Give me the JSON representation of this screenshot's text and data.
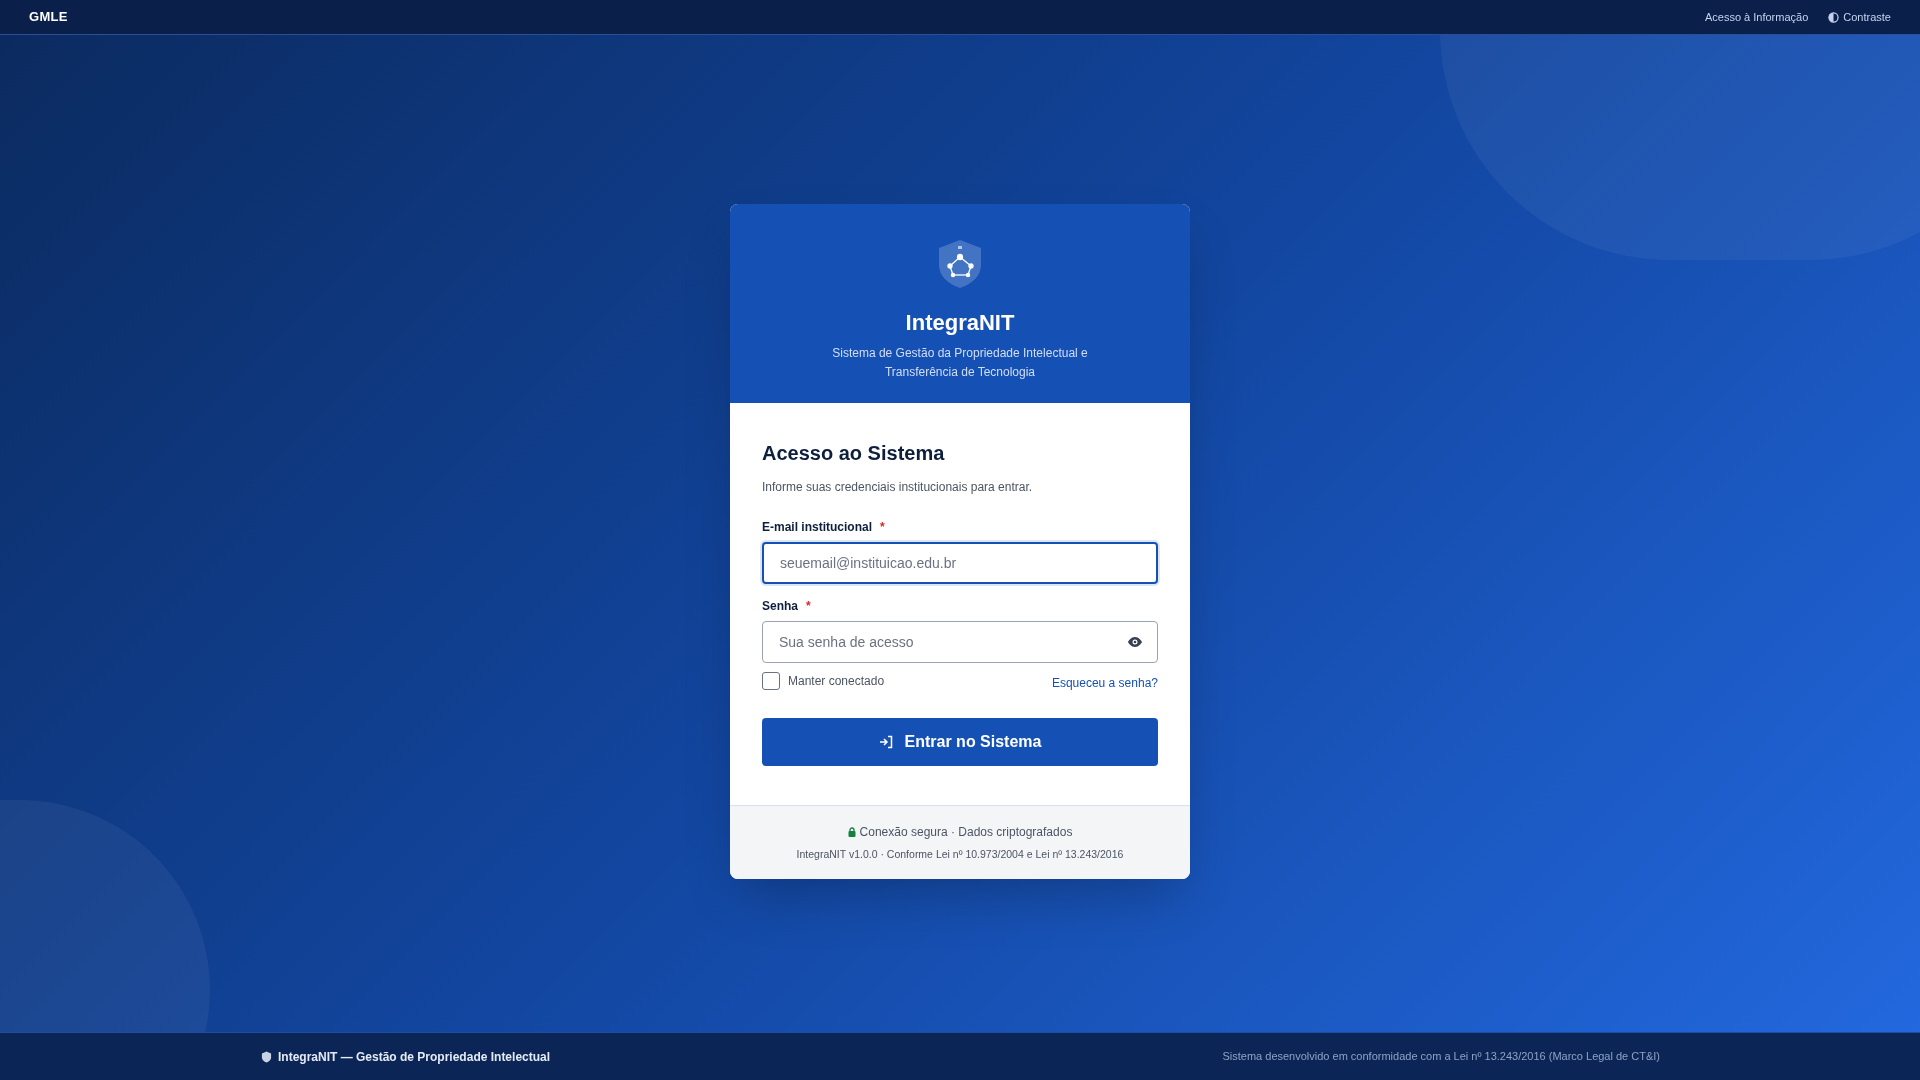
{
  "top_bar": {
    "logo": "GMLE",
    "links": [
      {
        "label": "Acesso à Informação",
        "kind": "link"
      },
      {
        "label": "Contraste",
        "kind": "contrast"
      }
    ]
  },
  "card": {
    "title": "IntegraNIT",
    "subtitle": "Sistema de Gestão da Propriedade Intelectual e Transferência de Tecnologia",
    "heading": "Acesso ao Sistema",
    "intro": "Informe suas credenciais institucionais para entrar.",
    "fields": [
      {
        "label": "E-mail institucional",
        "required_mark": "*",
        "placeholder": "seuemail@instituicao.edu.br",
        "kind": "email",
        "focused": true
      },
      {
        "label": "Senha",
        "required_mark": "*",
        "placeholder": "Sua senha de acesso",
        "kind": "password",
        "focused": false
      }
    ],
    "remember": {
      "label": "Manter conectado",
      "checked": false
    },
    "forgot_link": "Esqueceu a senha?",
    "submit": "Entrar no Sistema",
    "security_note": "Conexão segura · Dados criptografados",
    "version_note": "IntegraNIT v1.0.0 · Conforme Lei nº 10.973/2004 e Lei nº 13.243/2016"
  },
  "footer": {
    "brand": "IntegraNIT — Gestão de Propriedade Intelectual",
    "compliance": "Sistema desenvolvido em conformidade com a Lei nº 13.243/2016 (Marco Legal de CT&I)"
  }
}
